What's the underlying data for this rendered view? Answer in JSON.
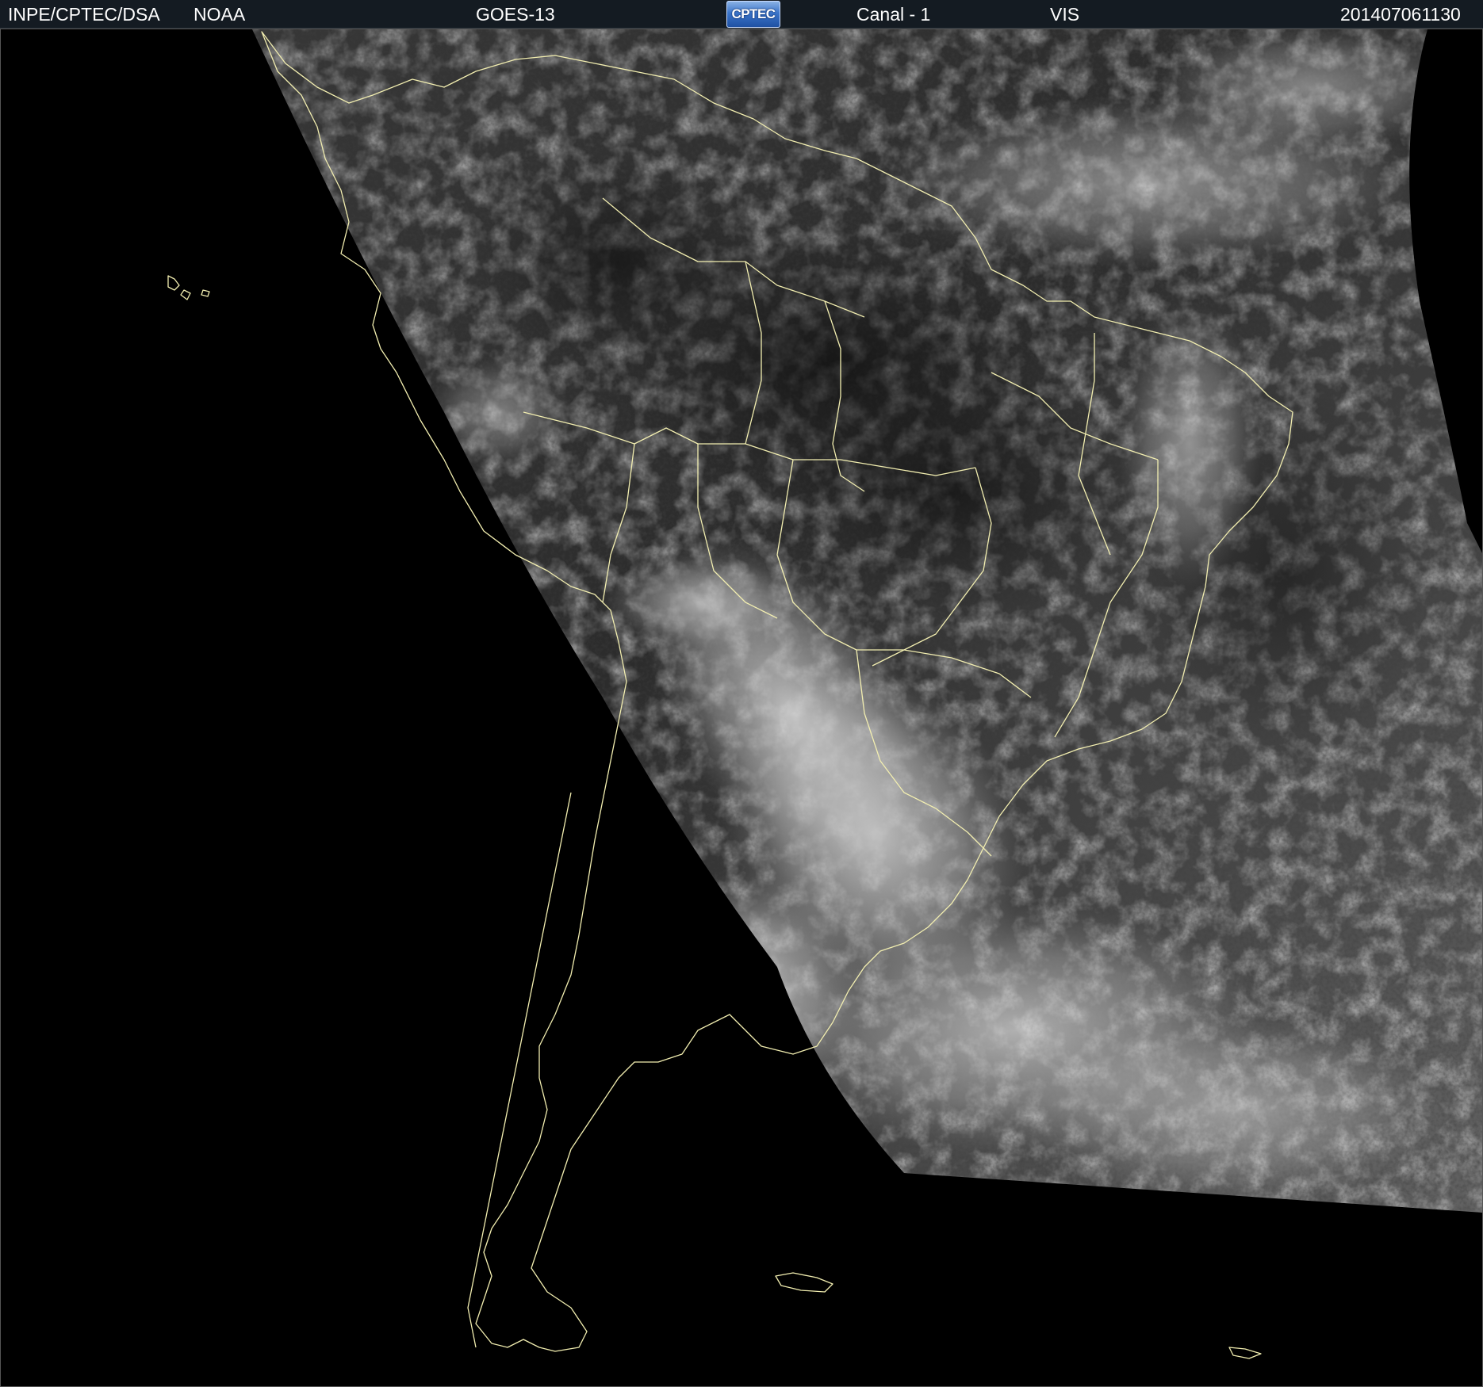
{
  "header": {
    "agency": "INPE/CPTEC/DSA",
    "partner": "NOAA",
    "satellite": "GOES-13",
    "logo_text": "CPTEC",
    "channel": "Canal - 1",
    "band": "VIS",
    "timestamp": "201407061130"
  },
  "image": {
    "description_colors": {
      "background": "#000000",
      "header_bg": "#141b22",
      "coastline": "#f2eeb0",
      "cloud_light": "#d8d8d8",
      "land_dark": "#2b2b2b"
    }
  }
}
